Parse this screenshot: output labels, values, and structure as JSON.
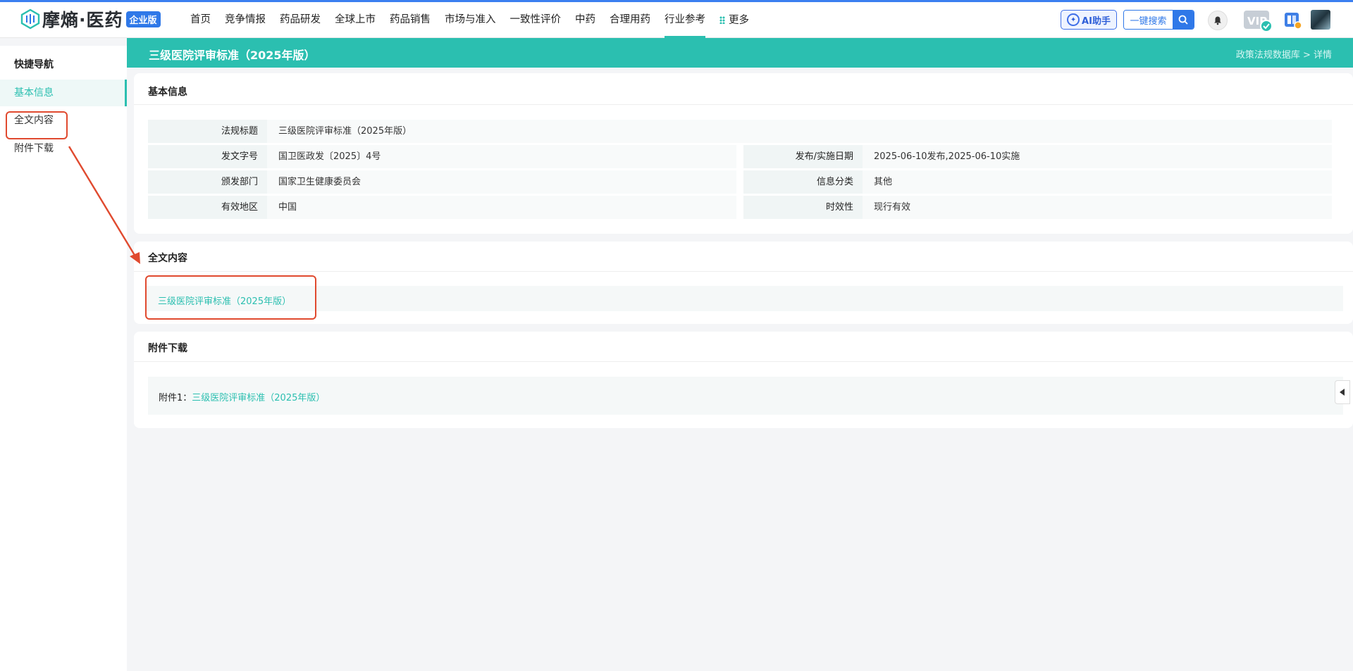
{
  "brand": {
    "name": "摩熵·医药",
    "badge": "企业版"
  },
  "nav": {
    "items": [
      "首页",
      "竞争情报",
      "药品研发",
      "全球上市",
      "药品销售",
      "市场与准入",
      "一致性评价",
      "中药",
      "合理用药",
      "行业参考"
    ],
    "active": "行业参考",
    "more_label": "更多"
  },
  "header_actions": {
    "ai_label": "AI助手",
    "search_label": "一键搜索",
    "vip_label": "VIP"
  },
  "page": {
    "title": "三级医院评审标准（2025年版）",
    "breadcrumb": "政策法规数据库 > 详情"
  },
  "sidebar": {
    "title": "快捷导航",
    "items": [
      "基本信息",
      "全文内容",
      "附件下载"
    ],
    "active": "基本信息"
  },
  "basic_info": {
    "section_title": "基本信息",
    "regulation_title_label": "法规标题",
    "regulation_title_value": "三级医院评审标准（2025年版）",
    "doc_number_label": "发文字号",
    "doc_number_value": "国卫医政发〔2025〕4号",
    "date_label": "发布/实施日期",
    "date_value": "2025-06-10发布,2025-06-10实施",
    "department_label": "颁发部门",
    "department_value": "国家卫生健康委员会",
    "category_label": "信息分类",
    "category_value": "其他",
    "region_label": "有效地区",
    "region_value": "中国",
    "validity_label": "时效性",
    "validity_value": "现行有效"
  },
  "full_text": {
    "section_title": "全文内容",
    "link_text": "三级医院评审标准（2025年版）"
  },
  "attachments": {
    "section_title": "附件下载",
    "prefix": "附件1：",
    "link_text": "三级医院评审标准（2025年版）"
  },
  "colors": {
    "accent": "#2bbfb0",
    "brand_blue": "#2f78e8",
    "annotation_red": "#e04a2f"
  }
}
